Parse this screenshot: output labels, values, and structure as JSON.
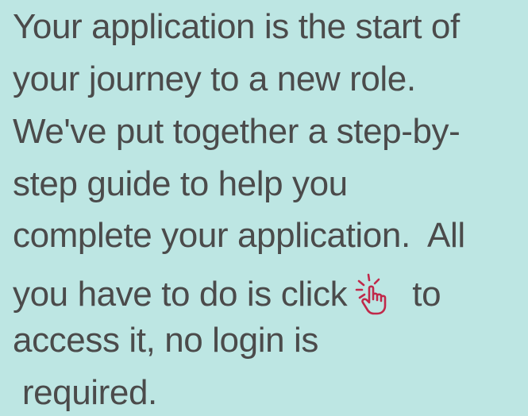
{
  "text": {
    "line1": "Your application is the start of",
    "line2": "your journey to a new role.",
    "line3": "We've put together a step-by-",
    "line4": "step guide to help you",
    "line5": "complete your application.  All",
    "line6_before": "you have to do is click",
    "line6_after": "to",
    "line7": "access it, no login is",
    "line8": " required."
  },
  "icon": {
    "name": "pointing-hand-click-icon",
    "color": "#c0294a"
  },
  "colors": {
    "background": "#bde6e3",
    "text": "#4b4b4b"
  }
}
